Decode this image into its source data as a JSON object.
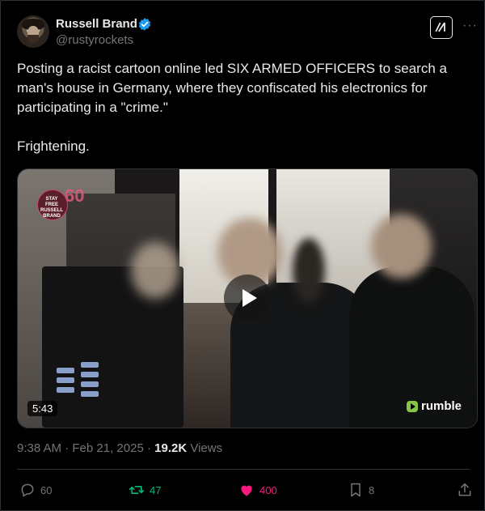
{
  "author": {
    "name": "Russell Brand",
    "handle": "@rustyrockets",
    "verified_color": "#1d9bf0"
  },
  "header_icons": [
    "grok-icon",
    "more-icon"
  ],
  "tweet": {
    "text": "Posting a racist cartoon online led SIX ARMED OFFICERS to search a man's house in Germany, where they confiscated his electronics for participating in a \"crime.\"",
    "text2": "Frightening."
  },
  "video": {
    "duration": "5:43",
    "provider": "rumble",
    "provider_color": "#85c742",
    "overlay_logo": {
      "line1": "STAY FREE",
      "line2": "RUSSELL",
      "line3": "BRAND",
      "number": "60"
    }
  },
  "meta": {
    "time": "9:38 AM",
    "date": "Feb 21, 2025",
    "views_count": "19.2K",
    "views_label": "Views",
    "separator": "·"
  },
  "actions": {
    "replies": "60",
    "reposts": "47",
    "likes": "400",
    "bookmarks": "8",
    "like_color": "#f91880",
    "repost_color": "#00ba7c"
  }
}
